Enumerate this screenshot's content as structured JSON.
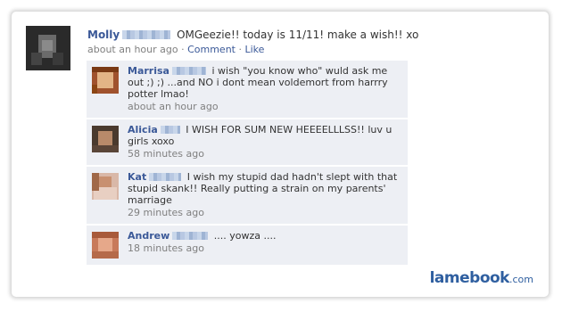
{
  "post": {
    "author": "Molly",
    "text": "OMGeezie!!  today is 11/11!  make a wish!! xo",
    "time": "about an hour ago",
    "separator": "·",
    "comment_link": "Comment",
    "like_link": "Like"
  },
  "comments": [
    {
      "author": "Marrisa",
      "text": "i wish \"you know who\" wuld ask me out ;) ;) ...and NO i dont mean voldemort from harrry potter lmao!",
      "time": "about an hour ago"
    },
    {
      "author": "Alicia",
      "text": "I WISH FOR SUM NEW HEEEELLLSS!! luv u girls xoxo",
      "time": "58 minutes ago"
    },
    {
      "author": "Kat",
      "text": "I wish my stupid dad hadn't slept with that stupid skank!!  Really putting a strain on my parents' marriage",
      "time": "29 minutes ago"
    },
    {
      "author": "Andrew",
      "text": ".... yowza ....",
      "time": "18 minutes ago"
    }
  ],
  "brand": {
    "name": "lamebook",
    "tld": ".com"
  },
  "colors": {
    "link": "#3b5998",
    "comment_bg": "#edeff4",
    "meta": "#808080",
    "brand": "#2f5fa0"
  }
}
